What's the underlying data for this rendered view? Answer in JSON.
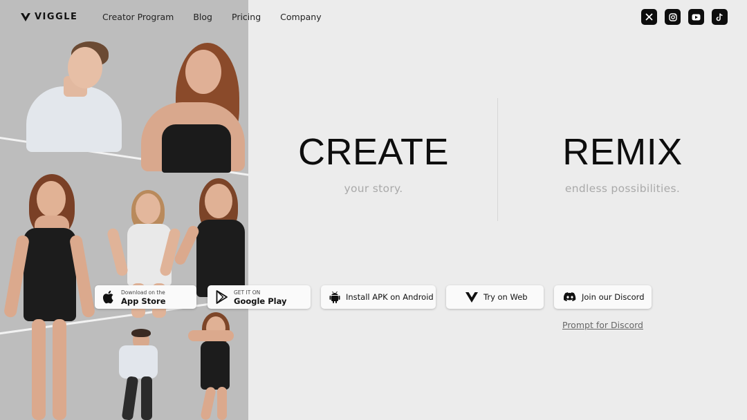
{
  "nav": {
    "logo_text": "VIGGLE",
    "links": [
      "Creator Program",
      "Blog",
      "Pricing",
      "Company"
    ]
  },
  "socials": [
    {
      "icon": "x-icon",
      "glyph": "𝕏"
    },
    {
      "icon": "instagram-icon",
      "glyph": "◎"
    },
    {
      "icon": "youtube-icon",
      "glyph": "▶"
    },
    {
      "icon": "tiktok-icon",
      "glyph": "♪"
    }
  ],
  "hero": {
    "left_title": "CREATE",
    "left_subtitle": "your story.",
    "right_title": "REMIX",
    "right_subtitle": "endless possibilities."
  },
  "buttons": {
    "app_store_small": "Download on the",
    "app_store_big": "App Store",
    "google_play_small": "GET IT ON",
    "google_play_big": "Google Play",
    "apk": "Install APK on Android",
    "web": "Try on Web",
    "discord": "Join our Discord"
  },
  "prompt_link": "Prompt for Discord",
  "colors": {
    "background": "#ececec",
    "collage_bg": "#bdbdbd",
    "dark": "#0d0d0d",
    "subtitle": "#a9a9a9"
  }
}
